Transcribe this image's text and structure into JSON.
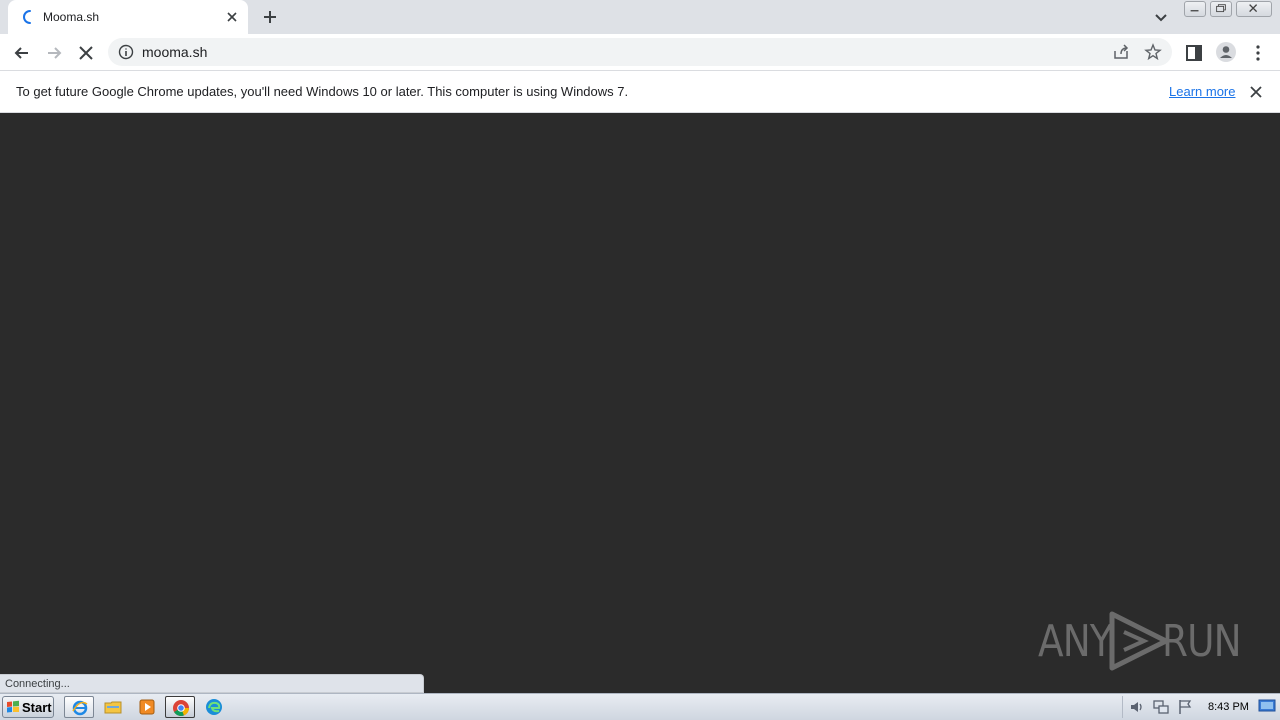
{
  "tab": {
    "title": "Mooma.sh"
  },
  "omnibox": {
    "url": "mooma.sh"
  },
  "infobar": {
    "message": "To get future Google Chrome updates, you'll need Windows 10 or later. This computer is using Windows 7.",
    "link": "Learn more"
  },
  "status": {
    "text": "Connecting..."
  },
  "watermark": {
    "text_left": "ANY",
    "text_right": "RUN"
  },
  "taskbar": {
    "start_label": "Start",
    "apps": [
      "internet-explorer-icon",
      "file-explorer-icon",
      "media-player-icon",
      "chrome-icon",
      "edge-icon"
    ],
    "clock": "8:43 PM"
  },
  "colors": {
    "content_bg": "#2b2b2b",
    "link": "#1a73e8",
    "tabstrip": "#dee1e6"
  }
}
